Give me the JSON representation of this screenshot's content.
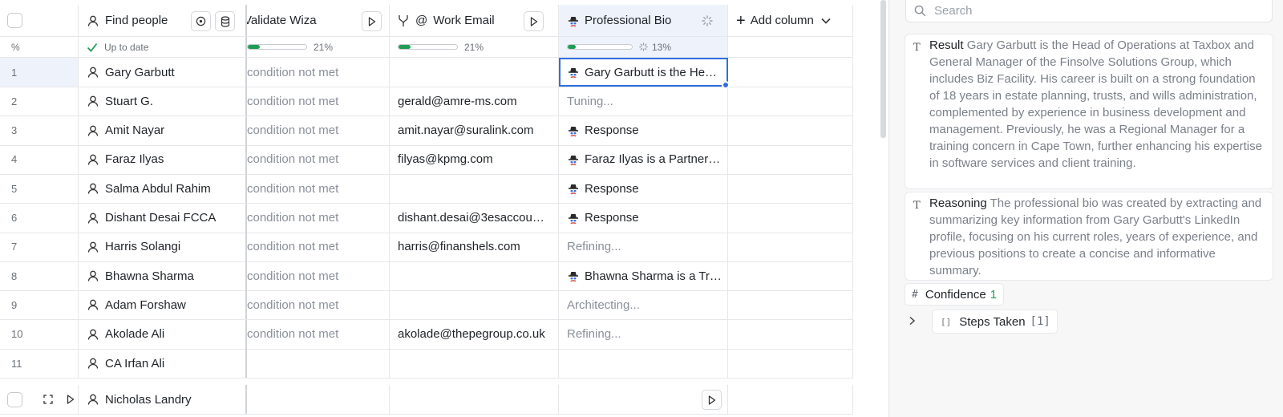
{
  "columns": {
    "find_people": "Find people",
    "validate_wiza": "Validate Wiza",
    "work_email": "Work Email",
    "professional_bio": "Professional Bio",
    "add_column": "Add column"
  },
  "status_row": {
    "percent_label": "%",
    "find_people_status": "Up to date",
    "validate_wiza_pct": "21%",
    "work_email_pct": "21%",
    "professional_bio_pct": "13%",
    "validate_wiza_progress": 0.21,
    "work_email_progress": 0.21,
    "professional_bio_progress": 0.13
  },
  "rows": [
    {
      "num": "1",
      "name": "Gary Garbutt",
      "wiza": "condition not met",
      "email": "",
      "bio": "Gary Garbutt is the He…",
      "bio_icon": true,
      "bio_muted": false
    },
    {
      "num": "2",
      "name": "Stuart G.",
      "wiza": "condition not met",
      "email": "gerald@amre-ms.com",
      "bio": "Tuning...",
      "bio_icon": false,
      "bio_muted": true
    },
    {
      "num": "3",
      "name": "Amit Nayar",
      "wiza": "condition not met",
      "email": "amit.nayar@suralink.com",
      "bio": "Response",
      "bio_icon": true,
      "bio_muted": false
    },
    {
      "num": "4",
      "name": "Faraz Ilyas",
      "wiza": "condition not met",
      "email": "filyas@kpmg.com",
      "bio": "Faraz Ilyas is a Partner…",
      "bio_icon": true,
      "bio_muted": false
    },
    {
      "num": "5",
      "name": "Salma Abdul Rahim",
      "wiza": "condition not met",
      "email": "",
      "bio": "Response",
      "bio_icon": true,
      "bio_muted": false
    },
    {
      "num": "6",
      "name": "Dishant Desai FCCA",
      "wiza": "condition not met",
      "email": "dishant.desai@3esaccou…",
      "bio": "Response",
      "bio_icon": true,
      "bio_muted": false
    },
    {
      "num": "7",
      "name": "Harris Solangi",
      "wiza": "condition not met",
      "email": "harris@finanshels.com",
      "bio": "Refining...",
      "bio_icon": false,
      "bio_muted": true
    },
    {
      "num": "8",
      "name": "Bhawna Sharma",
      "wiza": "condition not met",
      "email": "",
      "bio": "Bhawna Sharma is a Tr…",
      "bio_icon": true,
      "bio_muted": false
    },
    {
      "num": "9",
      "name": "Adam Forshaw",
      "wiza": "condition not met",
      "email": "",
      "bio": "Architecting...",
      "bio_icon": false,
      "bio_muted": true
    },
    {
      "num": "10",
      "name": "Akolade Ali",
      "wiza": "condition not met",
      "email": "akolade@thepegroup.co.uk",
      "bio": "Refining...",
      "bio_icon": false,
      "bio_muted": true
    },
    {
      "num": "11",
      "name": "CA Irfan Ali",
      "wiza": "",
      "email": "",
      "bio": "",
      "bio_icon": false,
      "bio_muted": false
    }
  ],
  "last_row": {
    "name": "Nicholas Landry"
  },
  "panel": {
    "search_placeholder": "Search",
    "result_key": "Result",
    "result_value": "Gary Garbutt is the Head of Operations at Taxbox and General Manager of the Finsolve Solutions Group, which includes Biz Facility. His career is built on a strong foundation of 18 years in estate planning, trusts, and wills administration, complemented by experience in business development and management. Previously, he was a Regional Manager for a training concern in Cape Town, further enhancing his expertise in software services and client training.",
    "reasoning_key": "Reasoning",
    "reasoning_value": "The professional bio was created by extracting and summarizing key information from Gary Garbutt's LinkedIn profile, focusing on his current roles, years of experience, and previous positions to create a concise and informative summary.",
    "text_type_icon": "T",
    "confidence_key": "Confidence",
    "confidence_value": "1",
    "number_type_icon": "#",
    "steps_key": "Steps Taken",
    "steps_count": "[1]",
    "array_type_icon": "[]"
  },
  "colors": {
    "accent": "#2f6fe0",
    "progress": "#1f9d55",
    "muted": "#8a8f98"
  }
}
